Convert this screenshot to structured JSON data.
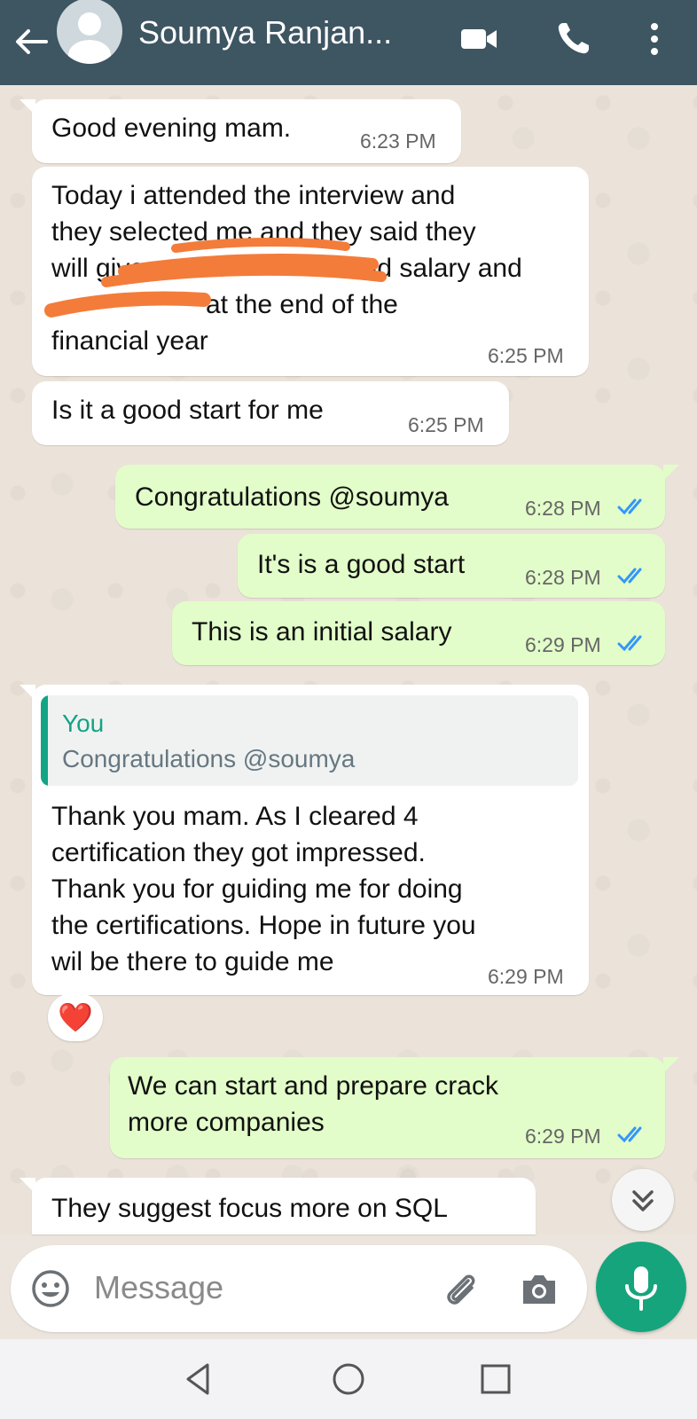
{
  "header": {
    "contact_name": "Soumya Ranjan...",
    "back_icon": "arrow-left-icon",
    "video_icon": "video-call-icon",
    "call_icon": "phone-icon",
    "menu_icon": "more-vert-icon",
    "bg_color": "#3e5562"
  },
  "messages": [
    {
      "dir": "in",
      "lines": [
        "Good evening mam."
      ],
      "time": "6:23 PM"
    },
    {
      "dir": "in",
      "lines": [
        "Today i attended the interview and",
        "they selected me and they said they",
        "will give",
        "and salary and",
        "at the end of the",
        "financial year"
      ],
      "time": "6:25 PM"
    },
    {
      "dir": "in",
      "lines": [
        "Is it a good start for me"
      ],
      "time": "6:25 PM"
    },
    {
      "dir": "out",
      "lines": [
        "Congratulations @soumya"
      ],
      "time": "6:28 PM"
    },
    {
      "dir": "out",
      "lines": [
        "It's is a good start"
      ],
      "time": "6:28 PM"
    },
    {
      "dir": "out",
      "lines": [
        "This is  an initial salary"
      ],
      "time": "6:29 PM"
    },
    {
      "dir": "in",
      "quote": {
        "author": "You",
        "text": "Congratulations @soumya"
      },
      "lines": [
        "Thank you mam. As I cleared 4",
        "certification they got impressed.",
        "Thank you for guiding me for doing",
        "the certifications. Hope in future you",
        "wil be there to guide me"
      ],
      "time": "6:29 PM",
      "reaction": "❤️"
    },
    {
      "dir": "out",
      "lines": [
        "We can start and prepare crack",
        "more companies"
      ],
      "time": "6:29 PM"
    },
    {
      "dir": "in",
      "lines": [
        "They suggest focus more on SQL"
      ],
      "time": ""
    }
  ],
  "composer": {
    "placeholder": "Message",
    "emoji_icon": "emoji-icon",
    "attach_icon": "paperclip-icon",
    "camera_icon": "camera-icon",
    "mic_icon": "mic-icon",
    "scroll_icon": "double-chevron-down-icon"
  },
  "colors": {
    "accent": "#16a47c",
    "outgoing_bubble": "#e2fdc9",
    "incoming_bubble": "#ffffff",
    "read_ticks": "#3497f9",
    "redaction": "#f37c3a"
  },
  "navbar": {
    "back_icon": "nav-back-icon",
    "home_icon": "nav-home-icon",
    "recents_icon": "nav-recents-icon"
  }
}
